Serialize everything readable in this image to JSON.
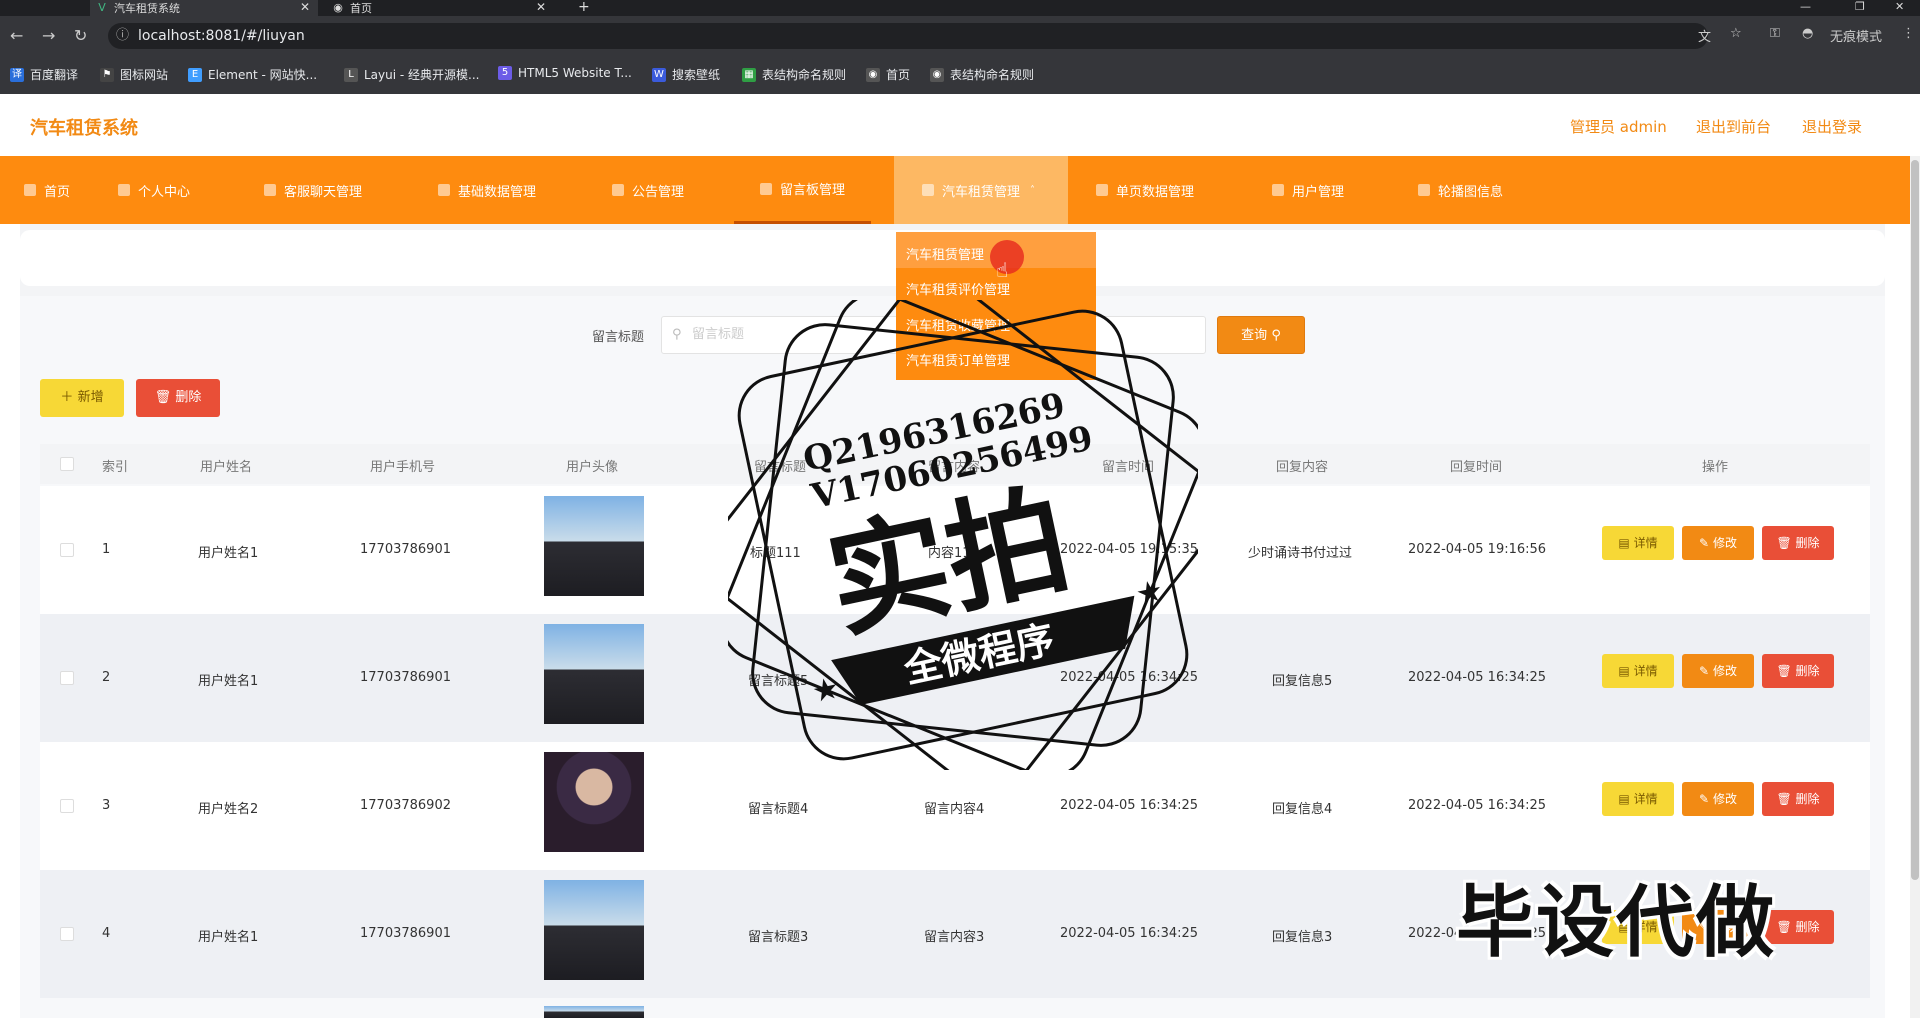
{
  "browser": {
    "tabs": [
      {
        "title": "汽车租赁系统",
        "active": true
      },
      {
        "title": "首页",
        "active": false
      }
    ],
    "url": "localhost:8081/#/liuyan",
    "incognito_label": "无痕模式",
    "bookmarks": [
      "百度翻译",
      "图标网站",
      "Element - 网站快...",
      "Layui - 经典开源模...",
      "HTML5 Website T...",
      "搜索壁纸",
      "表结构命名规则",
      "首页",
      "表结构命名规则"
    ]
  },
  "header": {
    "brand": "汽车租赁系统",
    "admin": "管理员 admin",
    "exit_front": "退出到前台",
    "logout": "退出登录"
  },
  "nav": {
    "items": [
      "首页",
      "个人中心",
      "客服聊天管理",
      "基础数据管理",
      "公告管理",
      "留言板管理",
      "汽车租赁管理",
      "单页数据管理",
      "用户管理",
      "轮播图信息"
    ],
    "dropdown": [
      "汽车租赁管理",
      "汽车租赁评价管理",
      "汽车租赁收藏管理",
      "汽车租赁订单管理"
    ]
  },
  "search": {
    "label": "留言标题",
    "placeholder": "留言标题",
    "button": "查询"
  },
  "actions": {
    "add": "新增",
    "delete": "删除"
  },
  "table": {
    "columns": [
      "索引",
      "用户姓名",
      "用户手机号",
      "用户头像",
      "留言标题",
      "留言内容",
      "留言时间",
      "回复内容",
      "回复时间",
      "操作"
    ],
    "row_actions": {
      "detail": "详情",
      "edit": "修改",
      "delete": "删除"
    },
    "rows": [
      {
        "index": "1",
        "name": "用户姓名1",
        "phone": "17703786901",
        "title": "标题111",
        "content": "内容111",
        "time": "2022-04-05 19:15:35",
        "reply": "少时诵诗书付过过",
        "reply_time": "2022-04-05 19:16:56"
      },
      {
        "index": "2",
        "name": "用户姓名1",
        "phone": "17703786901",
        "title": "留言标题5",
        "content": "",
        "time": "2022-04-05 16:34:25",
        "reply": "回复信息5",
        "reply_time": "2022-04-05 16:34:25"
      },
      {
        "index": "3",
        "name": "用户姓名2",
        "phone": "17703786902",
        "title": "留言标题4",
        "content": "留言内容4",
        "time": "2022-04-05 16:34:25",
        "reply": "回复信息4",
        "reply_time": "2022-04-05 16:34:25"
      },
      {
        "index": "4",
        "name": "用户姓名1",
        "phone": "17703786901",
        "title": "留言标题3",
        "content": "留言内容3",
        "time": "2022-04-05 16:34:25",
        "reply": "回复信息3",
        "reply_time": "2022-04-05 16:34:25"
      }
    ]
  },
  "watermark": {
    "line1": "Q2196316269",
    "line2": "V17060256499",
    "main": "实拍",
    "banner": "全微程序",
    "corner": "毕设代做"
  },
  "colors": {
    "accent": "#fe8b0f",
    "brand": "#f28a14",
    "yellow": "#f7d836",
    "red": "#e94f37"
  }
}
